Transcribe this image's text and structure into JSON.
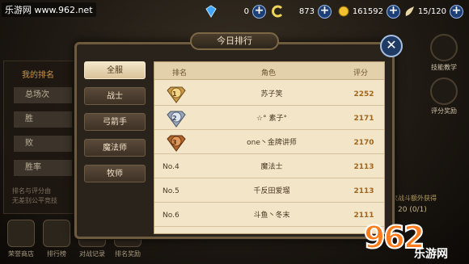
{
  "watermark": {
    "site": "乐游网 www.962.net",
    "logo_num": "962",
    "logo_text": "乐游网"
  },
  "resources": {
    "gems": "0",
    "coins_c": "873",
    "gold": "161592",
    "stamina": "15/120"
  },
  "left_panel": {
    "title": "我的排名",
    "rows": [
      "总场次",
      "胜",
      "败",
      "胜率"
    ],
    "note": "排名与评分由\n无差别公平竞技"
  },
  "bottom_buttons": [
    "荣誉商店",
    "排行榜",
    "对战记录",
    "排名奖励"
  ],
  "right_panel": {
    "items": [
      "技能教学",
      "评分奖励"
    ],
    "note": "次战斗额外获得",
    "reward": "20 (0/1)"
  },
  "dialog": {
    "title": "今日排行",
    "close": "✕",
    "tabs": [
      {
        "label": "全服",
        "active": true
      },
      {
        "label": "战士",
        "active": false
      },
      {
        "label": "弓箭手",
        "active": false
      },
      {
        "label": "魔法师",
        "active": false
      },
      {
        "label": "牧师",
        "active": false
      }
    ],
    "headers": {
      "rank": "排名",
      "role": "角色",
      "score": "评分"
    },
    "rows": [
      {
        "rank": "1",
        "medal": "gold",
        "name": "苏子笑",
        "score": "2252"
      },
      {
        "rank": "2",
        "medal": "silver",
        "name": "☆° 素子°",
        "score": "2171"
      },
      {
        "rank": "3",
        "medal": "bronze",
        "name": "one丶金牌讲师",
        "score": "2170"
      },
      {
        "rank": "No.4",
        "medal": "",
        "name": "魔法士",
        "score": "2113"
      },
      {
        "rank": "No.5",
        "medal": "",
        "name": "千反田爱瑠",
        "score": "2113"
      },
      {
        "rank": "No.6",
        "medal": "",
        "name": "斗鱼丶冬末",
        "score": "2111"
      }
    ]
  }
}
